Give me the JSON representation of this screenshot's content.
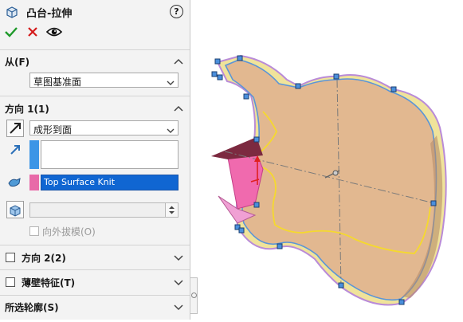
{
  "feature": {
    "title": "凸台-拉伸",
    "help_icon": "?"
  },
  "actions": {
    "ok": "ok-checkmark-icon",
    "cancel": "cancel-x-icon",
    "preview": "eye-icon"
  },
  "from_section": {
    "title": "从(F)",
    "start_condition": "草图基准面"
  },
  "direction1": {
    "title": "方向 1(1)",
    "end_condition": "成形到面",
    "selected_face": "Top Surface Knit",
    "draft_outward_label": "向外拔模(O)",
    "draft_outward_checked": false
  },
  "direction2": {
    "title": "方向 2(2)",
    "checked": false
  },
  "thin_feature": {
    "title": "薄壁特征(T)",
    "checked": false
  },
  "selected_contours": {
    "title": "所选轮廓(S)"
  },
  "colors": {
    "accent_blue": "#3c95e6",
    "pink_selection": "#e86aa8",
    "selection_highlight": "#1066d2",
    "model_body": "#e2b890",
    "model_edge": "#f5e69a"
  }
}
